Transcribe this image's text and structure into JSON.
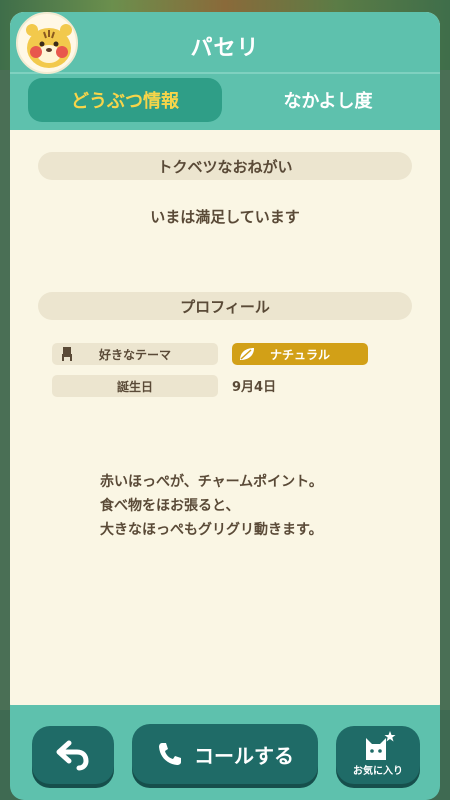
{
  "villager": {
    "name": "パセリ"
  },
  "tabs": [
    {
      "label": "どうぶつ情報"
    },
    {
      "label": "なかよし度"
    }
  ],
  "request_section": {
    "title": "トクベツなおねがい",
    "text": "いまは満足しています"
  },
  "profile_section": {
    "title": "プロフィール",
    "favorite_theme_label": "好きなテーマ",
    "favorite_theme_value": "ナチュラル",
    "birthday_label": "誕生日",
    "birthday_value": "9月4日"
  },
  "catchphrase": {
    "line1": "赤いほっぺが、チャームポイント。",
    "line2": "食べ物をほお張ると、",
    "line3": "大きなほっぺもグリグリ動きます。"
  },
  "bottom": {
    "call_label": "コールする",
    "favorite_label": "お気に入り"
  },
  "colors": {
    "header_teal": "#5ec1ad",
    "active_tab": "#2f9e87",
    "active_tab_text": "#f7d54a",
    "theme_badge": "#d2a017",
    "button_dark": "#1f6b67"
  },
  "icons": {
    "avatar": "villager-avatar",
    "theme": "leaf-icon",
    "theme_label": "chair-icon",
    "back": "back-arrow-icon",
    "call": "phone-icon",
    "favorite": "cat-star-icon"
  }
}
